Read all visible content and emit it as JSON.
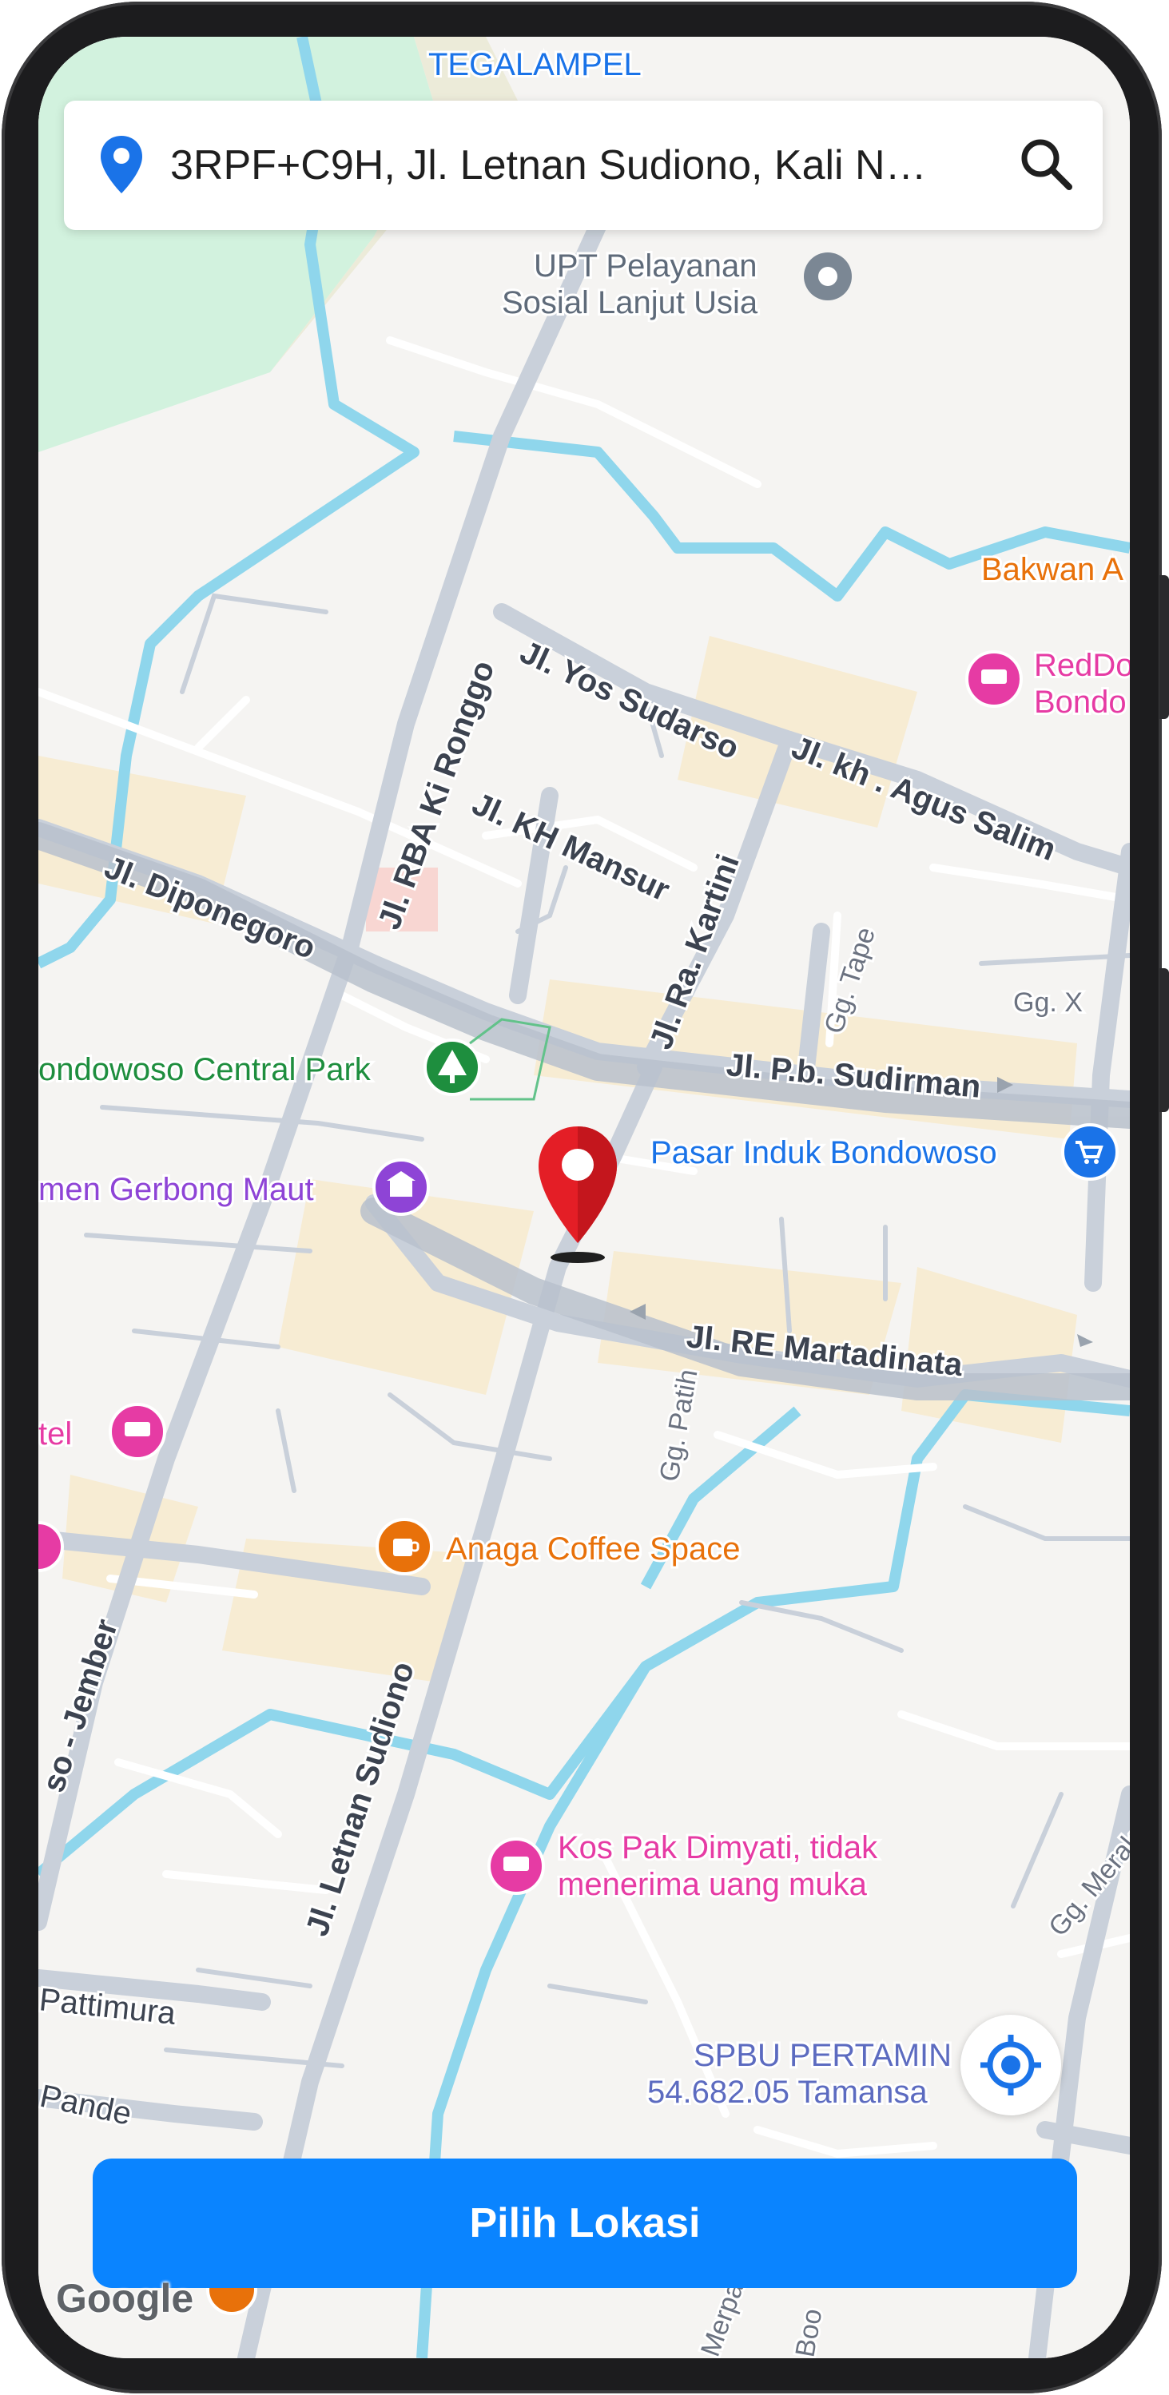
{
  "search": {
    "address": "3RPF+C9H, Jl. Letnan Sudiono, Kali N…",
    "pin_icon": "location-pin-icon",
    "search_icon": "search-icon"
  },
  "map": {
    "areas": [
      "TEGALAMPEL"
    ],
    "roads": [
      "Jl. Yos Sudarso",
      "Jl. kh . Agus Salim",
      "Jl. RBA Ki Ronggo",
      "Jl. KH Mansur",
      "Jl. Ra. Kartini",
      "Jl. Diponegoro",
      "Gg. Tape",
      "Gg. X",
      "Jl. P.b. Sudirman",
      "Jl. RE Martadinata",
      "Gg. Patih",
      "so - Jember",
      "Jl. Letnan Sudiono",
      "Pattimura",
      "Pande",
      "Gg. Merak",
      "Merpa",
      "Boo"
    ],
    "places": [
      {
        "name_line1": "UPT Pelayanan",
        "name_line2": "Sosial Lanjut Usia",
        "icon": "place-marker-icon",
        "color": "#5f6b7a"
      },
      {
        "name": "Bakwan A",
        "color": "#e8710a"
      },
      {
        "name_line1": "RedDo",
        "name_line2": "Bondo",
        "icon": "hotel-icon",
        "color": "#e63ba4"
      },
      {
        "name": "ondowoso Central Park",
        "icon": "park-icon",
        "color": "#1e8e3e"
      },
      {
        "name": "Pasar Induk Bondowoso",
        "icon": "shopping-cart-icon",
        "color": "#1a73e8"
      },
      {
        "name": "men Gerbong Maut",
        "icon": "museum-icon",
        "color": "#8e44d6"
      },
      {
        "name": "tel",
        "icon": "hotel-icon",
        "color": "#e63ba4"
      },
      {
        "name": "Anaga Coffee Space",
        "icon": "coffee-icon",
        "color": "#e8710a"
      },
      {
        "name_line1": "Kos Pak Dimyati, tidak",
        "name_line2": "menerima uang muka",
        "icon": "hotel-icon",
        "color": "#e63ba4"
      },
      {
        "name_line1": "SPBU PERTAMIN",
        "name_line2": "54.682.05 Tamansa",
        "color": "#5c6bc0"
      }
    ],
    "attribution": "Google"
  },
  "controls": {
    "locate_icon": "my-location-icon",
    "pick_label": "Pilih Lokasi",
    "accent": "#0a84ff",
    "pin_color": "#e41e26"
  }
}
